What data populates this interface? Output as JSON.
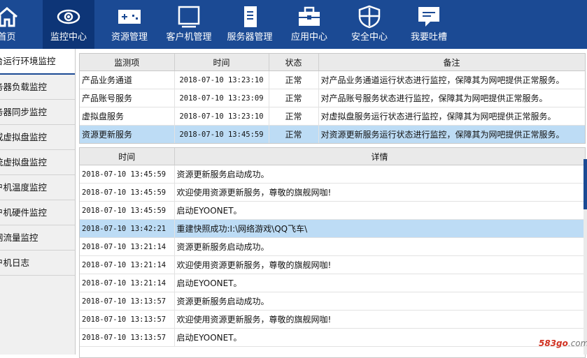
{
  "nav": {
    "items": [
      {
        "label": "首页",
        "icon": "home-icon"
      },
      {
        "label": "监控中心",
        "icon": "eye-icon"
      },
      {
        "label": "资源管理",
        "icon": "gamepad-icon"
      },
      {
        "label": "客户机管理",
        "icon": "monitor-icon"
      },
      {
        "label": "服务器管理",
        "icon": "server-icon"
      },
      {
        "label": "应用中心",
        "icon": "toolbox-icon"
      },
      {
        "label": "安全中心",
        "icon": "shield-icon"
      },
      {
        "label": "我要吐槽",
        "icon": "chat-icon"
      }
    ],
    "active_index": 1
  },
  "sidebar": {
    "items": [
      {
        "label": "台运行环境监控"
      },
      {
        "label": "务器负载监控"
      },
      {
        "label": "务器同步监控"
      },
      {
        "label": "或虚拟盘监控"
      },
      {
        "label": "统虚拟盘监控"
      },
      {
        "label": "户机温度监控"
      },
      {
        "label": "户机硬件监控"
      },
      {
        "label": "网流量监控"
      },
      {
        "label": "户机日志"
      }
    ],
    "active_index": 0
  },
  "monitor_table": {
    "headers": {
      "item": "监测项",
      "time": "时间",
      "status": "状态",
      "note": "备注"
    },
    "rows": [
      {
        "item": "产品业务通道",
        "time": "2018-07-10 13:23:10",
        "status": "正常",
        "note": "对产品业务通道运行状态进行监控，保障其为网吧提供正常服务。"
      },
      {
        "item": "产品账号服务",
        "time": "2018-07-10 13:23:09",
        "status": "正常",
        "note": "对产品账号服务状态进行监控，保障其为网吧提供正常服务。"
      },
      {
        "item": "虚拟盘服务",
        "time": "2018-07-10 13:23:10",
        "status": "正常",
        "note": "对虚拟盘服务运行状态进行监控，保障其为网吧提供正常服务。"
      },
      {
        "item": "资源更新服务",
        "time": "2018-07-10 13:45:59",
        "status": "正常",
        "note": "对资源更新服务运行状态进行监控，保障其为网吧提供正常服务。"
      }
    ],
    "selected_index": 3
  },
  "log_table": {
    "headers": {
      "time": "时间",
      "detail": "详情"
    },
    "rows": [
      {
        "time": "2018-07-10 13:45:59",
        "detail": "资源更新服务启动成功。"
      },
      {
        "time": "2018-07-10 13:45:59",
        "detail": "欢迎使用资源更新服务，尊敬的旗舰网咖!"
      },
      {
        "time": "2018-07-10 13:45:59",
        "detail": "启动EYOONET。"
      },
      {
        "time": "2018-07-10 13:42:21",
        "detail": "重建快照成功:I:\\网络游戏\\QQ飞车\\"
      },
      {
        "time": "2018-07-10 13:21:14",
        "detail": "资源更新服务启动成功。"
      },
      {
        "time": "2018-07-10 13:21:14",
        "detail": "欢迎使用资源更新服务，尊敬的旗舰网咖!"
      },
      {
        "time": "2018-07-10 13:21:14",
        "detail": "启动EYOONET。"
      },
      {
        "time": "2018-07-10 13:13:57",
        "detail": "资源更新服务启动成功。"
      },
      {
        "time": "2018-07-10 13:13:57",
        "detail": "欢迎使用资源更新服务，尊敬的旗舰网咖!"
      },
      {
        "time": "2018-07-10 13:13:57",
        "detail": "启动EYOONET。"
      }
    ],
    "selected_index": 3
  },
  "watermark": {
    "brand": "583go",
    "suffix": ".com"
  }
}
